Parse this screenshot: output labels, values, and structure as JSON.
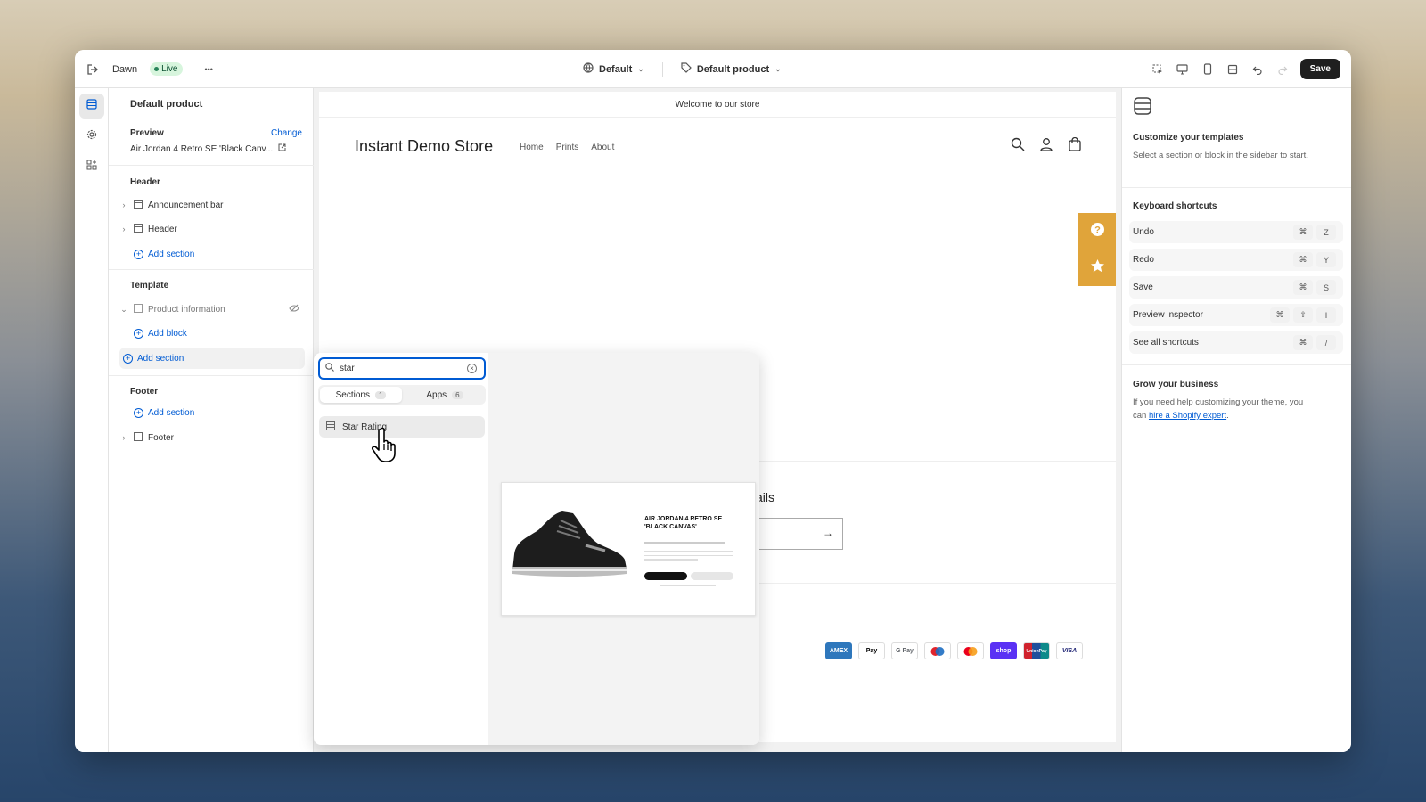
{
  "topbar": {
    "theme_name": "Dawn",
    "live_label": "Live",
    "more_label": "•••",
    "theme_select": "Default",
    "template_select": "Default product",
    "save_label": "Save"
  },
  "sidebar": {
    "title": "Default product",
    "preview_label": "Preview",
    "change_label": "Change",
    "product_name": "Air Jordan 4 Retro SE 'Black Canv...",
    "header_group": "Header",
    "header_items": [
      "Announcement bar",
      "Header"
    ],
    "add_section": "Add section",
    "template_group": "Template",
    "template_item": "Product information",
    "add_block": "Add block",
    "footer_group": "Footer",
    "footer_item": "Footer"
  },
  "store": {
    "announcement": "Welcome to our store",
    "name": "Instant Demo Store",
    "nav": [
      "Home",
      "Prints",
      "About"
    ],
    "emails_fragment": "ails",
    "payments": [
      "AMEX",
      "Pay",
      "G Pay",
      "",
      "",
      "shop",
      "UnionPay",
      "VISA"
    ]
  },
  "popover": {
    "search_value": "star",
    "tabs": [
      {
        "label": "Sections",
        "count": "1"
      },
      {
        "label": "Apps",
        "count": "6"
      }
    ],
    "result": "Star Rating",
    "thumb_title": "AIR JORDAN 4 RETRO SE 'BLACK CANVAS'"
  },
  "rpanel": {
    "customize_title": "Customize your templates",
    "customize_text": "Select a section or block in the sidebar to start.",
    "shortcuts_title": "Keyboard shortcuts",
    "shortcuts": [
      {
        "label": "Undo",
        "keys": [
          "⌘",
          "Z"
        ]
      },
      {
        "label": "Redo",
        "keys": [
          "⌘",
          "Y"
        ]
      },
      {
        "label": "Save",
        "keys": [
          "⌘",
          "S"
        ]
      },
      {
        "label": "Preview inspector",
        "keys": [
          "⌘",
          "⇧",
          "I"
        ]
      },
      {
        "label": "See all shortcuts",
        "keys": [
          "⌘",
          "/"
        ]
      }
    ],
    "grow_title": "Grow your business",
    "grow_text": "If you need help customizing your theme, you can",
    "grow_link": "hire a Shopify expert",
    "grow_end": "."
  },
  "colors": {
    "accent": "#005bd3",
    "live_bg": "#d7f5dd",
    "floating_widget": "#e0a43a",
    "save_button": "#1f1f1f"
  }
}
